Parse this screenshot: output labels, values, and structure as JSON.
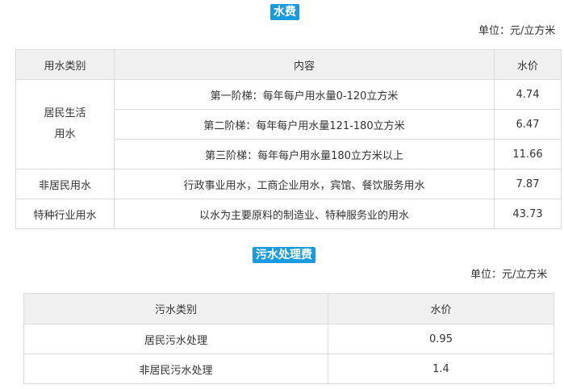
{
  "water_fee": {
    "title": "水费",
    "unit_note": "单位：元/立方米",
    "headers": {
      "category": "用水类别",
      "content": "内容",
      "price": "水价"
    },
    "residential": {
      "category": "居民生活\n用水",
      "tiers": [
        {
          "content": "第一阶梯：每年每户用水量0-120立方米",
          "price": "4.74"
        },
        {
          "content": "第二阶梯：每年每户用水量121-180立方米",
          "price": "6.47"
        },
        {
          "content": "第三阶梯：每年每户用水量180立方米以上",
          "price": "11.66"
        }
      ]
    },
    "non_residential": {
      "category": "非居民用水",
      "content": "行政事业用水，工商企业用水，宾馆、餐饮服务用水",
      "price": "7.87"
    },
    "special": {
      "category": "特种行业用水",
      "content": "以水为主要原料的制造业、特种服务业的用水",
      "price": "43.73"
    }
  },
  "sewage_fee": {
    "title": "污水处理费",
    "unit_note": "单位：元/立方米",
    "headers": {
      "category": "污水类别",
      "price": "水价"
    },
    "rows": [
      {
        "category": "居民污水处理",
        "price": "0.95"
      },
      {
        "category": "非居民污水处理",
        "price": "1.4"
      }
    ]
  },
  "colors": {
    "title_background": "#1a9be0",
    "header_background": "#f0f0f0",
    "border": "#dcdcdc"
  }
}
